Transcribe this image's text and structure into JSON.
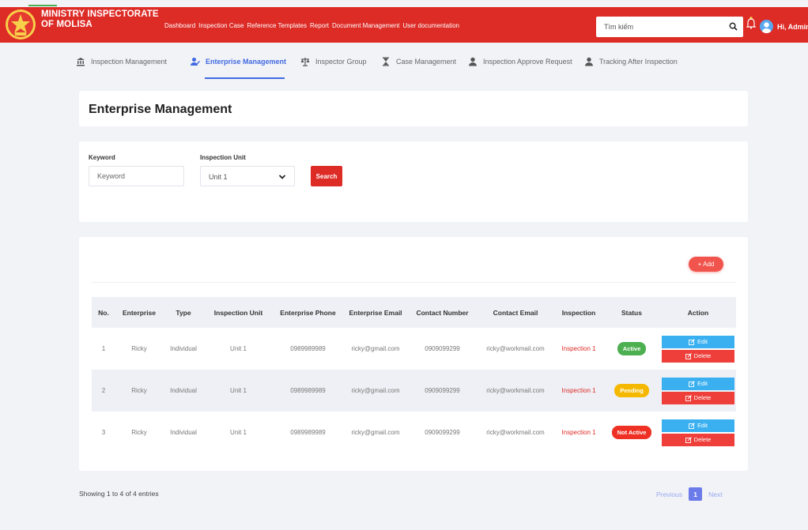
{
  "header": {
    "brand_line1": "MINISTRY INSPECTORATE",
    "brand_line2": "OF MOLISA",
    "nav": [
      "Dashboard",
      "Inspection Case",
      "Reference Templates",
      "Report",
      "Document Management",
      "User documentation"
    ],
    "search_placeholder": "Tìm kiếm",
    "user_greeting": "Hi, Admin",
    "brand_color": "#dd2b26"
  },
  "subnav": {
    "items": [
      {
        "label": "Inspection Management",
        "icon": "bank-icon"
      },
      {
        "label": "Enterprise Management",
        "icon": "user-edit-icon",
        "active": true
      },
      {
        "label": "Inspector Group",
        "icon": "scale-icon"
      },
      {
        "label": "Case Management",
        "icon": "hourglass-icon"
      },
      {
        "label": "Inspection Approve Request",
        "icon": "user-icon"
      },
      {
        "label": "Tracking After Inspection",
        "icon": "user-icon"
      }
    ],
    "active_color": "#4169e1"
  },
  "page": {
    "title": "Enterprise Management"
  },
  "filters": {
    "keyword_label": "Keyword",
    "keyword_placeholder": "Keyword",
    "unit_label": "Inspection Unit",
    "unit_value": "Unit 1",
    "search_label": "Search"
  },
  "table": {
    "add_label": "+ Add",
    "columns": [
      "No.",
      "Enterprise",
      "Type",
      "Inspection Unit",
      "Enterprise Phone",
      "Enterprise Email",
      "Contact Number",
      "Contact Email",
      "Inspection",
      "Status",
      "Action"
    ],
    "rows": [
      {
        "no": "1",
        "enterprise": "Ricky",
        "type": "Individual",
        "unit": "Unit 1",
        "phone": "0989989989",
        "email": "ricky@gmail.com",
        "contact_number": "0909099299",
        "contact_email": "ricky@workmail.com",
        "inspection": "Inspection 1",
        "status": "Active"
      },
      {
        "no": "2",
        "enterprise": "Ricky",
        "type": "Individual",
        "unit": "Unit 1",
        "phone": "0989989989",
        "email": "ricky@gmail.com",
        "contact_number": "0909099299",
        "contact_email": "ricky@workmail.com",
        "inspection": "Inspection 1",
        "status": "Pending"
      },
      {
        "no": "3",
        "enterprise": "Ricky",
        "type": "Individual",
        "unit": "Unit 1",
        "phone": "0989989989",
        "email": "ricky@gmail.com",
        "contact_number": "0909099299",
        "contact_email": "ricky@workmail.com",
        "inspection": "Inspection 1",
        "status": "Not Active"
      }
    ],
    "edit_label": "Edit",
    "delete_label": "Delete",
    "status_colors": {
      "Active": "#4caf50",
      "Pending": "#f5b800",
      "Not Active": "#ee3124"
    }
  },
  "pagination": {
    "showing": "Showing 1 to 4 of 4 entries",
    "previous": "Previous",
    "current_page": "1",
    "next": "Next"
  }
}
